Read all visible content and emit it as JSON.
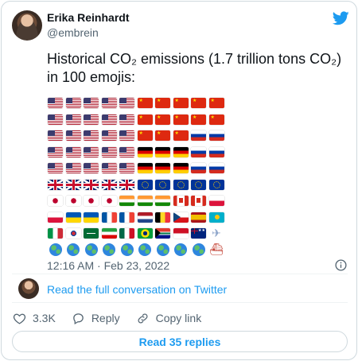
{
  "author": {
    "name": "Erika Reinhardt",
    "handle": "@embrein"
  },
  "tweet": {
    "text": "Historical CO₂ emissions (1.7 trillion tons CO₂) in 100 emojis:",
    "timestamp": "12:16 AM · Feb 23, 2022"
  },
  "emoji_grid": [
    [
      "us",
      "us",
      "us",
      "us",
      "us",
      "cn",
      "cn",
      "cn",
      "cn",
      "cn"
    ],
    [
      "us",
      "us",
      "us",
      "us",
      "us",
      "cn",
      "cn",
      "cn",
      "cn",
      "cn"
    ],
    [
      "us",
      "us",
      "us",
      "us",
      "us",
      "cn",
      "cn",
      "cn",
      "ru",
      "ru"
    ],
    [
      "us",
      "us",
      "us",
      "us",
      "us",
      "de",
      "de",
      "de",
      "ru",
      "ru"
    ],
    [
      "us",
      "us",
      "us",
      "us",
      "us",
      "de",
      "de",
      "de",
      "ru",
      "ru"
    ],
    [
      "gb",
      "gb",
      "gb",
      "gb",
      "gb",
      "eu",
      "eu",
      "eu",
      "eu",
      "eu"
    ],
    [
      "jp",
      "jp",
      "jp",
      "jp",
      "in",
      "in",
      "in",
      "ca",
      "ca",
      "pl"
    ],
    [
      "pl",
      "ua",
      "ua",
      "fr",
      "fr",
      "nl",
      "be",
      "cz",
      "es",
      "kz"
    ],
    [
      "it",
      "kr",
      "sa",
      "ir",
      "mx",
      "br",
      "za",
      "id",
      "au",
      "plane"
    ],
    [
      "globe",
      "globe",
      "globe",
      "globe",
      "globe",
      "globe",
      "globe",
      "globe",
      "globe",
      "ship"
    ]
  ],
  "icons": {
    "brand": "twitter-bird-icon",
    "info": "info-icon",
    "like": "heart-icon",
    "reply": "reply-icon",
    "copy": "link-icon"
  },
  "links": {
    "read_full": "Read the full conversation on Twitter"
  },
  "actions": {
    "like_count": "3.3K",
    "reply_label": "Reply",
    "copy_label": "Copy link"
  },
  "read_replies": "Read 35 replies",
  "colors": {
    "accent": "#1d9bf0",
    "muted": "#536471",
    "text": "#0f1419",
    "border": "#cfd9de"
  }
}
